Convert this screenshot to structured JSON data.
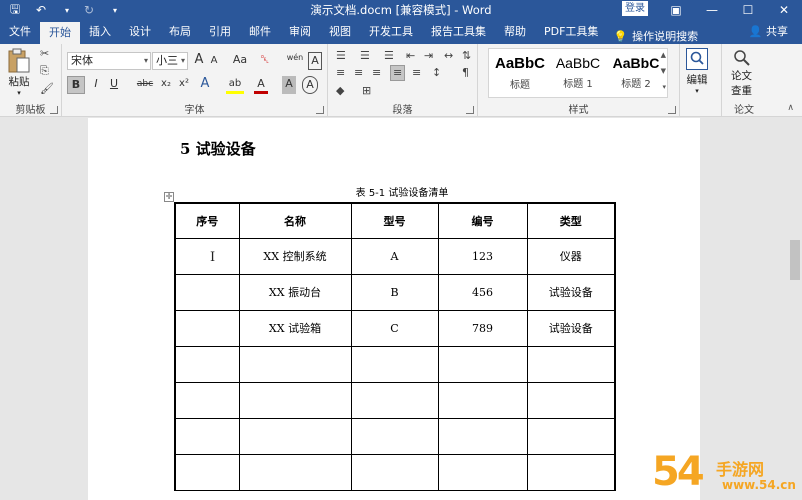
{
  "titlebar": {
    "document_title": "演示文档.docm [兼容模式] - Word",
    "login_label": "登录"
  },
  "tabs": [
    "文件",
    "开始",
    "插入",
    "设计",
    "布局",
    "引用",
    "邮件",
    "审阅",
    "视图",
    "开发工具",
    "报告工具集",
    "帮助",
    "PDF工具集"
  ],
  "active_tab": "开始",
  "tell_me": "操作说明搜索",
  "share_label": "共享",
  "ribbon": {
    "clipboard": {
      "paste_label": "粘贴",
      "group_label": "剪贴板"
    },
    "font": {
      "font_name": "宋体",
      "font_size": "小三",
      "group_label": "字体",
      "grow": "A",
      "shrink": "A",
      "case": "Aa",
      "phonetic": "wén",
      "border_char": "A",
      "bold": "B",
      "italic": "I",
      "underline": "U",
      "strike": "abc",
      "subscript": "x₂",
      "superscript": "x²",
      "effects": "A",
      "highlight": "ab",
      "font_color": "A",
      "shading": "A",
      "enclose": "A"
    },
    "paragraph": {
      "group_label": "段落"
    },
    "styles": {
      "group_label": "样式",
      "items": [
        {
          "sample": "AaBbC",
          "name": "标题"
        },
        {
          "sample": "AaBbC",
          "name": "标题 1"
        },
        {
          "sample": "AaBbC",
          "name": "标题 2"
        }
      ]
    },
    "editing": {
      "label": "编辑"
    },
    "paper": {
      "label1": "论文",
      "label2": "查重",
      "group_label": "论文"
    }
  },
  "document": {
    "heading": "5  试验设备",
    "caption": "表 5-1   试验设备清单",
    "table": {
      "headers": [
        "序号",
        "名称",
        "型号",
        "编号",
        "类型"
      ],
      "rows": [
        [
          "",
          "XX 控制系统",
          "A",
          "123",
          "仪器"
        ],
        [
          "",
          "XX 振动台",
          "B",
          "456",
          "试验设备"
        ],
        [
          "",
          "XX 试验箱",
          "C",
          "789",
          "试验设备"
        ],
        [
          "",
          "",
          "",
          "",
          ""
        ],
        [
          "",
          "",
          "",
          "",
          ""
        ],
        [
          "",
          "",
          "",
          "",
          ""
        ],
        [
          "",
          "",
          "",
          "",
          ""
        ]
      ]
    }
  },
  "watermark": {
    "number": "54",
    "text": "手游网",
    "url": "www.54.cn"
  },
  "colors": {
    "word_blue": "#2b579a",
    "ribbon_bg": "#f3f3f3",
    "watermark_orange": "#f5a623"
  }
}
